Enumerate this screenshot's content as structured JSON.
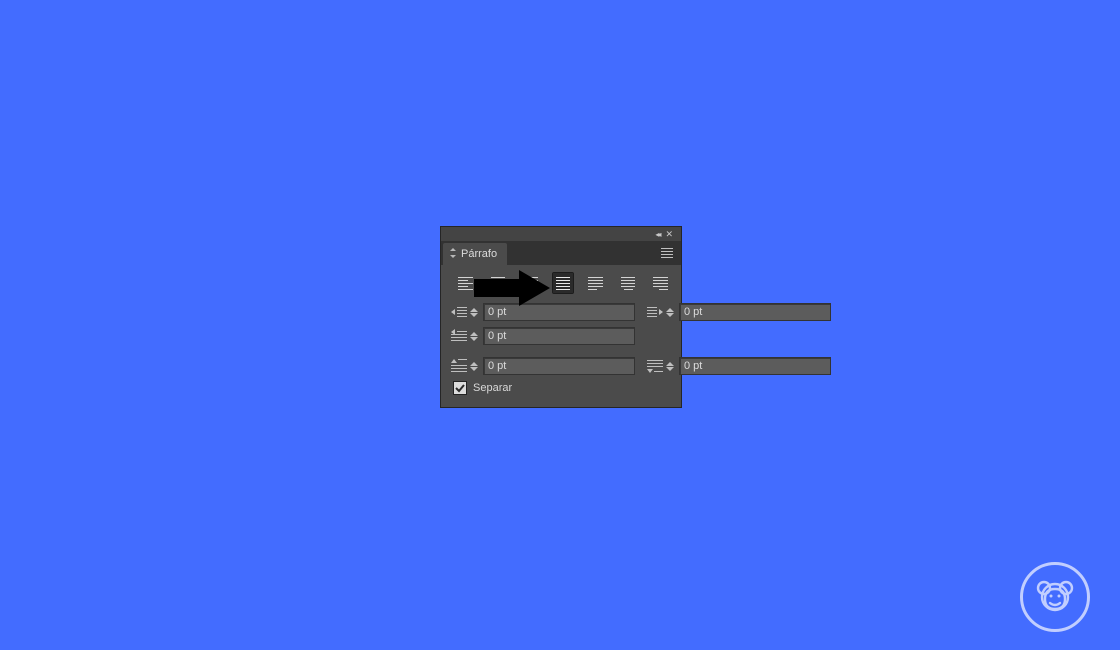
{
  "panel": {
    "tab_title": "Párrafo",
    "checkbox_label": "Separar",
    "checkbox_checked": true
  },
  "alignments": [
    {
      "name": "align-left"
    },
    {
      "name": "align-center"
    },
    {
      "name": "align-right"
    },
    {
      "name": "justify-last-left"
    },
    {
      "name": "justify-last-center"
    },
    {
      "name": "justify-last-right"
    },
    {
      "name": "justify-all"
    }
  ],
  "selected_alignment": 3,
  "fields": {
    "indent_left": "0 pt",
    "indent_right": "0 pt",
    "first_line_indent": "0 pt",
    "space_before": "0 pt",
    "space_after": "0 pt"
  },
  "colors": {
    "bg": "#436cff",
    "panel": "#4b4b4b"
  }
}
